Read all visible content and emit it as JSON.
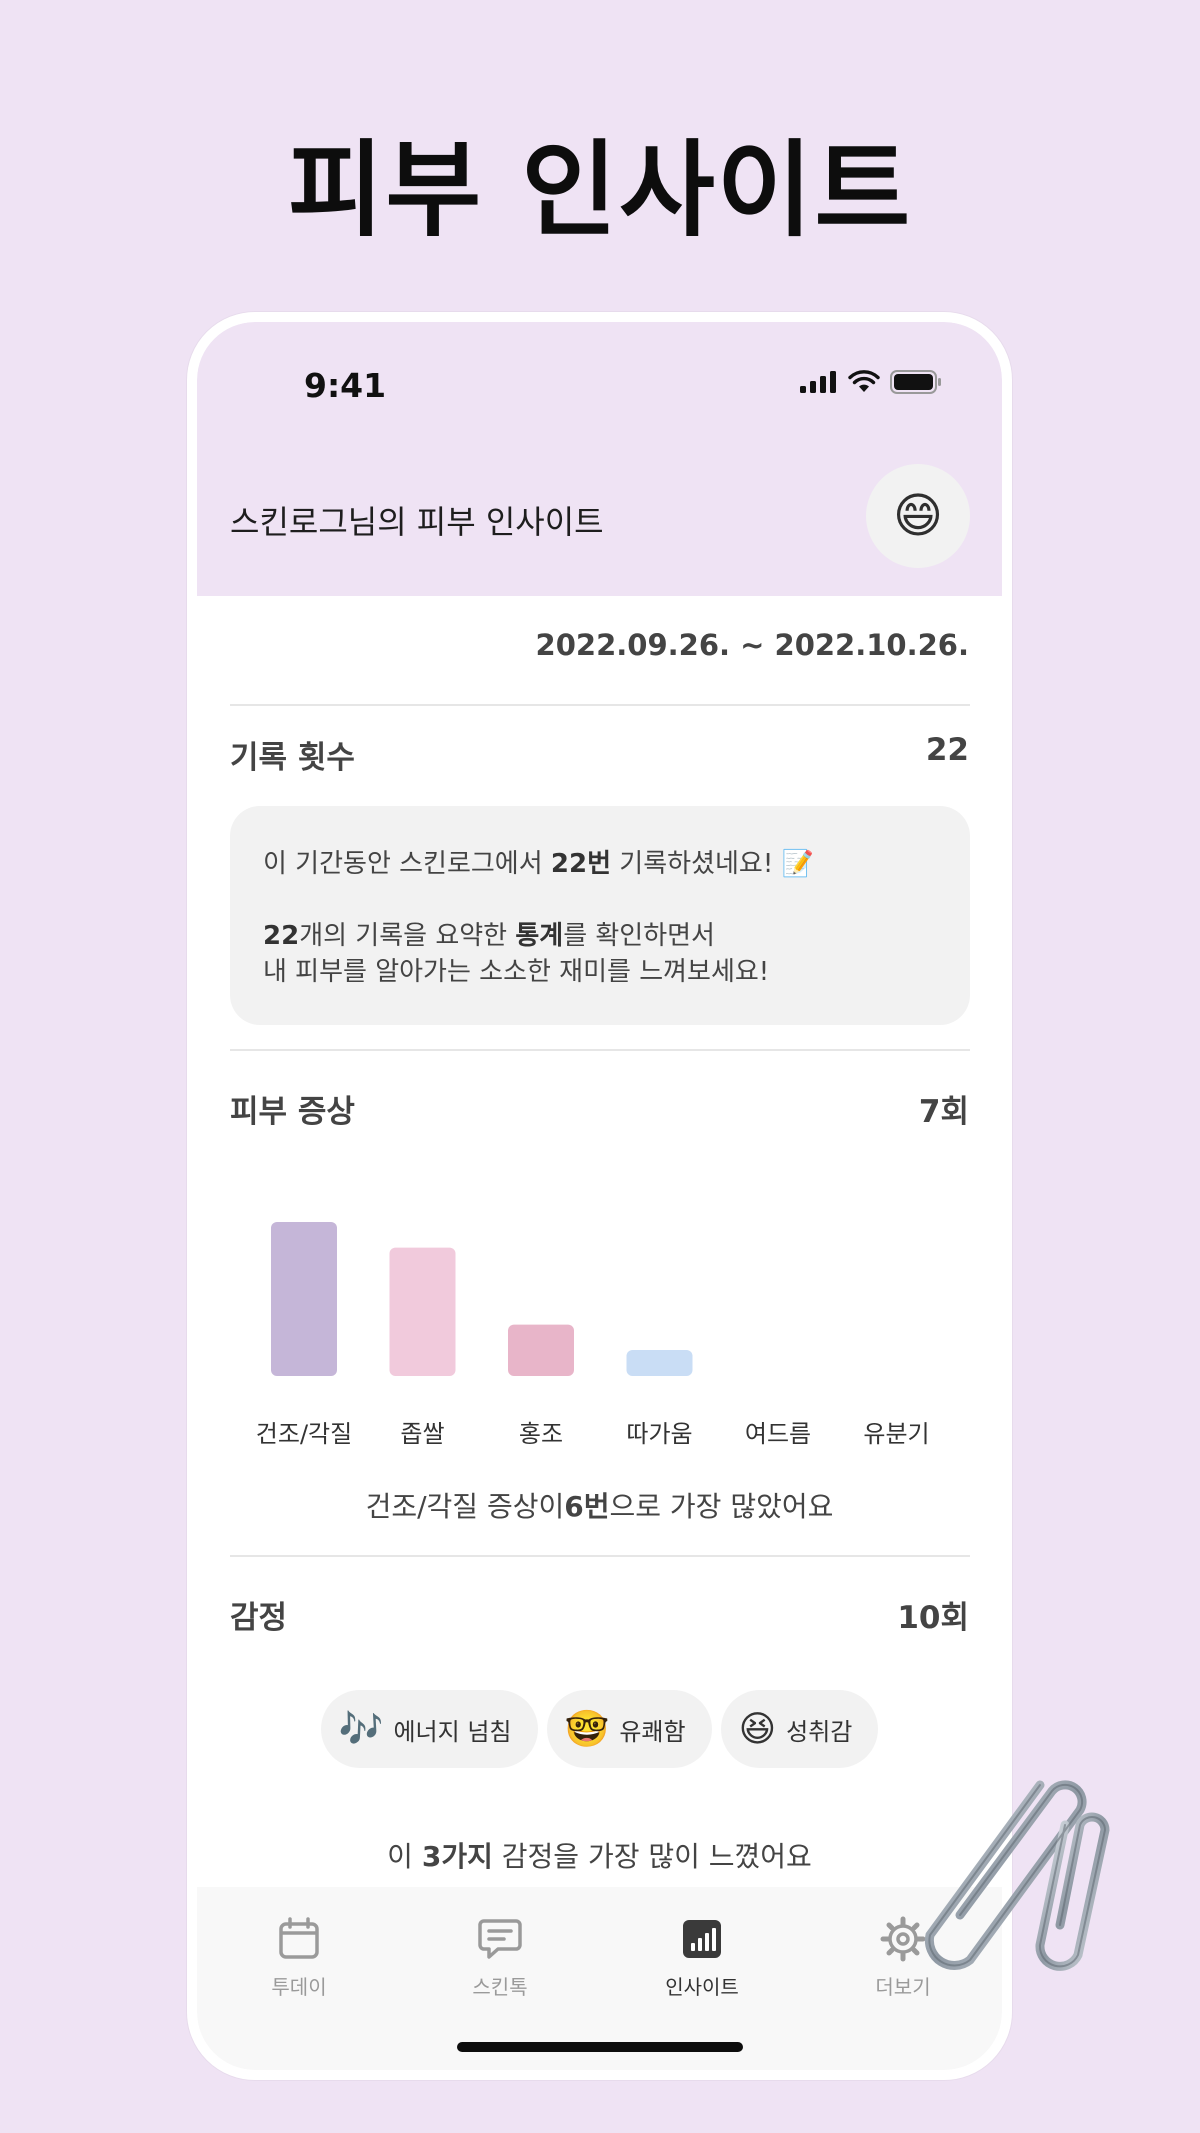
{
  "hero_title": "피부 인사이트",
  "status_bar": {
    "time": "9:41"
  },
  "header": {
    "title": "스킨로그님의 피부 인사이트",
    "avatar_emoji": "😄"
  },
  "date_range": "2022.09.26. ~ 2022.10.26.",
  "records": {
    "title": "기록 횟수",
    "count": "22",
    "message_line1_a": "이 기간동안 스킨로그에서 ",
    "message_line1_b": "22번",
    "message_line1_c": " 기록하셨네요! 📝",
    "message_line2_a": "22",
    "message_line2_b": "개의 기록을 요약한 ",
    "message_line2_c": "통계",
    "message_line2_d": "를 확인하면서",
    "message_line3": "내 피부를 알아가는 소소한 재미를 느껴보세요!"
  },
  "symptoms": {
    "title": "피부 증상",
    "count": "7회",
    "caption_a": "건조/각질 증상이",
    "caption_b": "6번",
    "caption_c": "으로 가장 많았어요"
  },
  "chart_data": {
    "type": "bar",
    "categories": [
      "건조/각질",
      "좁쌀",
      "홍조",
      "따가움",
      "여드름",
      "유분기"
    ],
    "values": [
      6,
      5,
      2,
      1,
      0,
      0
    ],
    "colors": [
      "#c5b6d8",
      "#f1cadc",
      "#e8b5c9",
      "#c9ddf5",
      "#eeeeee",
      "#eeeeee"
    ],
    "ylim": [
      0,
      6
    ]
  },
  "emotions": {
    "title": "감정",
    "count": "10회",
    "chips": [
      {
        "emoji": "🎶",
        "label": "에너지 넘침"
      },
      {
        "emoji": "🤓",
        "label": "유쾌함"
      },
      {
        "emoji": "😆",
        "label": "성취감"
      }
    ],
    "caption_a": "이 ",
    "caption_b": "3가지",
    "caption_c": " 감정을 가장 많이 느꼈어요"
  },
  "tabs": [
    {
      "label": "투데이",
      "icon": "calendar-icon"
    },
    {
      "label": "스킨톡",
      "icon": "chat-icon"
    },
    {
      "label": "인사이트",
      "icon": "chart-icon"
    },
    {
      "label": "더보기",
      "icon": "gear-icon"
    }
  ],
  "colors": {
    "background": "#efe3f4",
    "active_tab": "#333333",
    "inactive_tab": "#9a9a9a"
  }
}
